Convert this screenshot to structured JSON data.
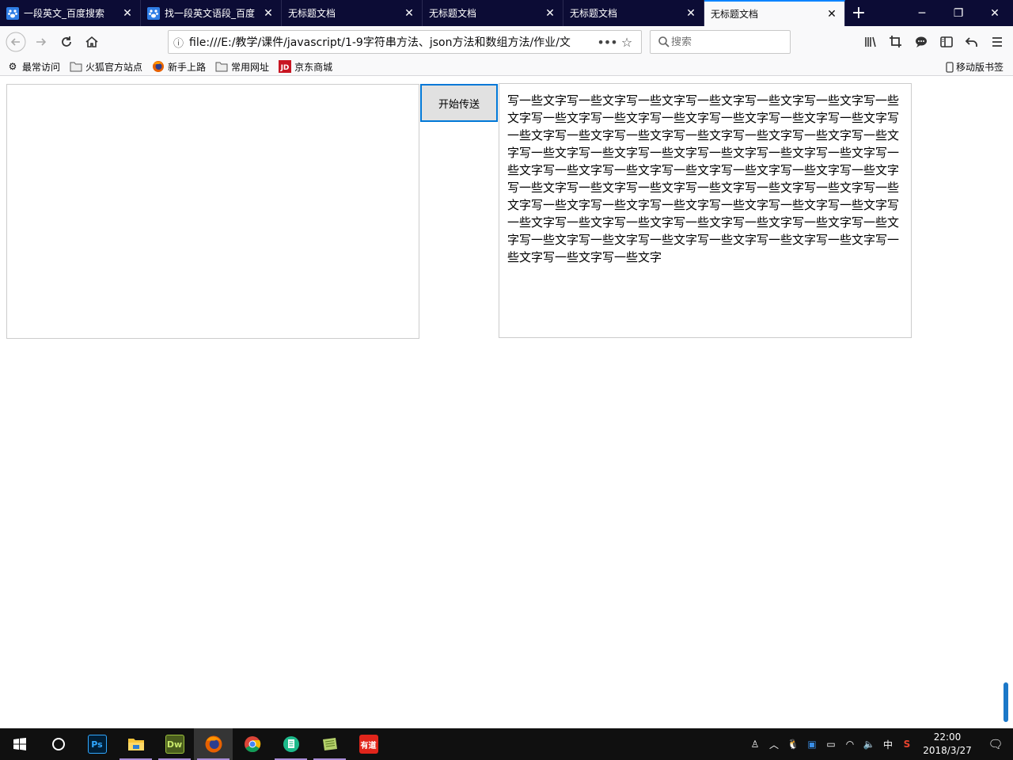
{
  "tabs": [
    {
      "title": "一段英文_百度搜索",
      "icon": "baidu-paw-icon",
      "active": false
    },
    {
      "title": "找一段英文语段_百度",
      "icon": "baidu-paw-icon",
      "active": false
    },
    {
      "title": "无标题文档",
      "icon": "",
      "active": false
    },
    {
      "title": "无标题文档",
      "icon": "",
      "active": false
    },
    {
      "title": "无标题文档",
      "icon": "",
      "active": false
    },
    {
      "title": "无标题文档",
      "icon": "",
      "active": true
    }
  ],
  "urlbar": {
    "url": "file:///E:/教学/课件/javascript/1-9字符串方法、json方法和数组方法/作业/文"
  },
  "search": {
    "placeholder": "搜索"
  },
  "bookmarks": {
    "items": [
      {
        "label": "最常访问",
        "icon": "gear-icon"
      },
      {
        "label": "火狐官方站点",
        "icon": "folder-icon"
      },
      {
        "label": "新手上路",
        "icon": "firefox-icon"
      },
      {
        "label": "常用网址",
        "icon": "folder-icon"
      },
      {
        "label": "京东商城",
        "icon": "jd-icon"
      }
    ],
    "mobile": "移动版书签"
  },
  "page": {
    "send_button": "开始传送",
    "text": "写一些文字写一些文字写一些文字写一些文字写一些文字写一些文字写一些文字写一些文字写一些文字写一些文字写一些文字写一些文字写一些文字写一些文字写一些文字写一些文字写一些文字写一些文字写一些文字写一些文字写一些文字写一些文字写一些文字写一些文字写一些文字写一些文字写一些文字写一些文字写一些文字写一些文字写一些文字写一些文字写一些文字写一些文字写一些文字写一些文字写一些文字写一些文字写一些文字写一些文字写一些文字写一些文字写一些文字写一些文字写一些文字写一些文字写一些文字写一些文字写一些文字写一些文字写一些文字写一些文字写一些文字写一些文字写一些文字写一些文字写一些文字写一些文字写一些文字写一些文字写一些文字写一些文字"
  },
  "taskbar": {
    "apps": [
      "Ps",
      "explorer",
      "Dw",
      "firefox",
      "chrome",
      "notes",
      "edit",
      "有道"
    ],
    "clock_time": "22:00",
    "clock_date": "2018/3/27",
    "ime": "中"
  }
}
